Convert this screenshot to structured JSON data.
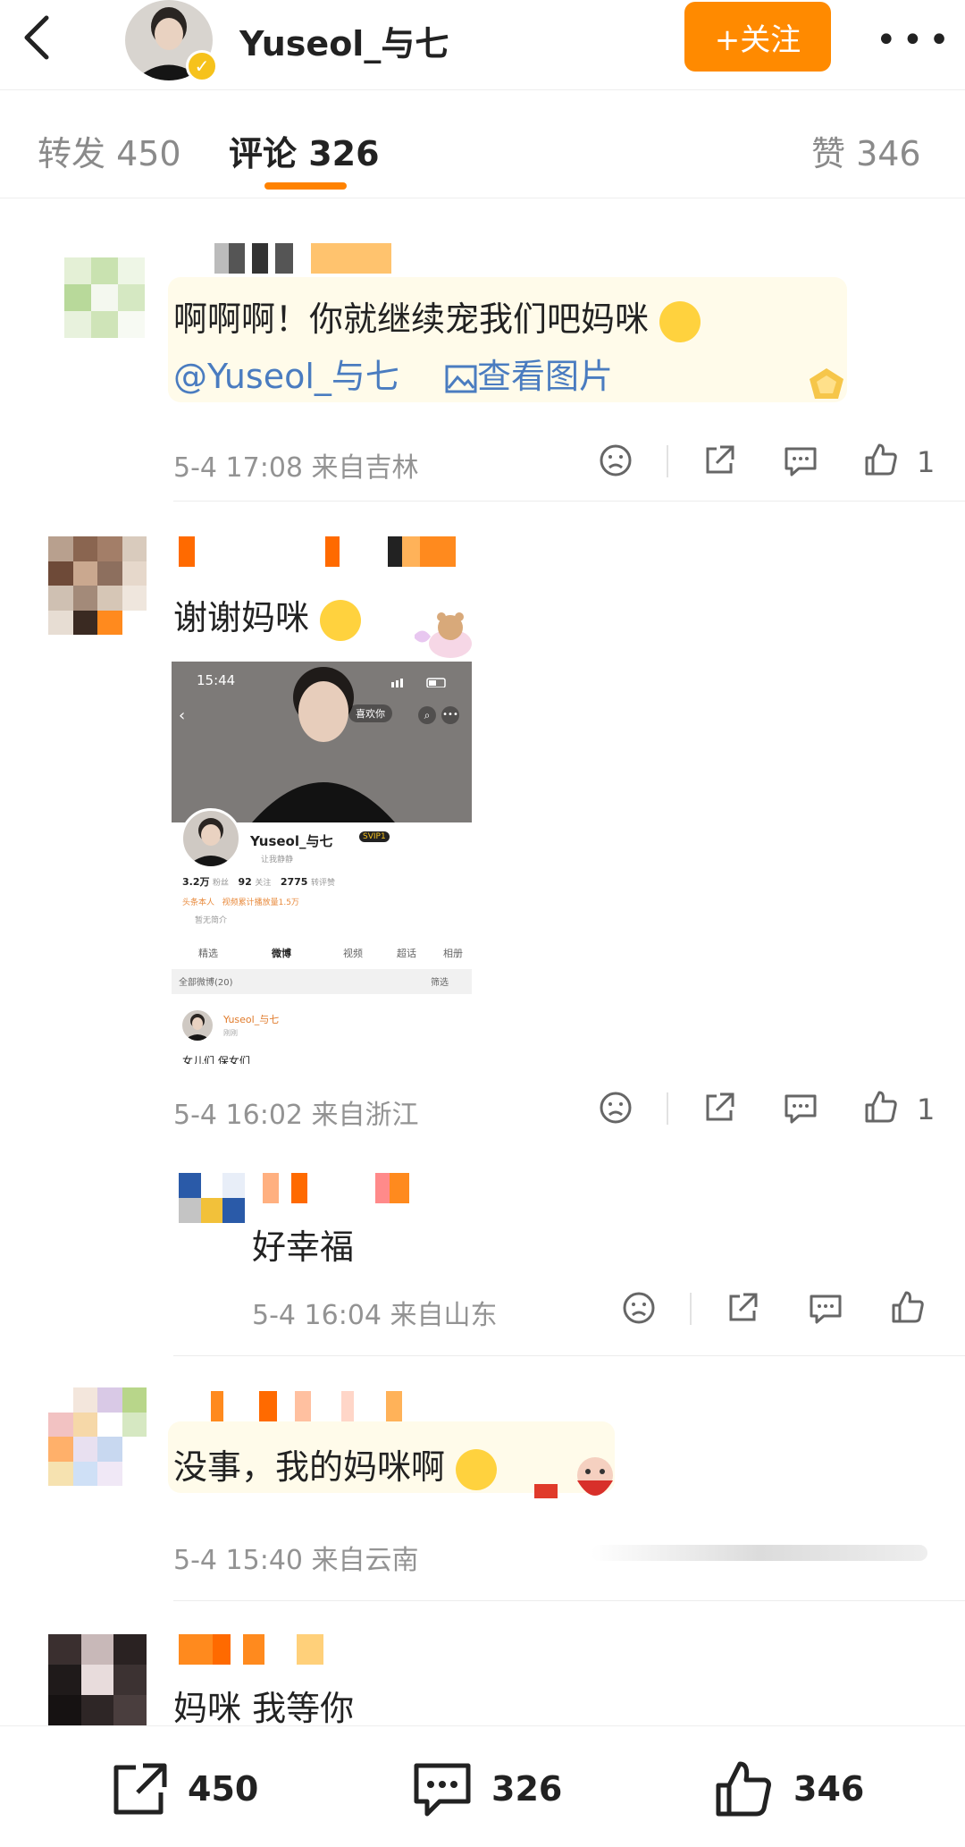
{
  "header": {
    "username": "Yuseol_与七",
    "follow_label": "+关注"
  },
  "tabs": {
    "repost": "转发 450",
    "comments": "评论 326",
    "likes": "赞 346"
  },
  "comments": [
    {
      "text": "啊啊啊！你就继续宠我们吧妈咪",
      "mention": "@Yuseol_与七",
      "view_image": "查看图片",
      "meta": "5-4 17:08 来自吉林",
      "like_count": "1"
    },
    {
      "text": "谢谢妈咪",
      "meta": "5-4 16:02 来自浙江",
      "like_count": "1",
      "reply": {
        "text": "好幸福",
        "meta": "5-4 16:04 来自山东"
      }
    },
    {
      "text": "没事，我的妈咪啊",
      "meta": "5-4 15:40 来自云南"
    },
    {
      "text": "妈咪 我等你"
    }
  ],
  "embedded_screenshot": {
    "time": "15:44",
    "like_chip": "喜欢你",
    "profile_name": "Yuseol_与七",
    "vip": "SVIP1",
    "sub": "让我静静",
    "fans_num": "3.2万",
    "fans_label": "粉丝",
    "follow_num": "92",
    "follow_label": "关注",
    "zan_num": "2775",
    "zan_label": "转评赞",
    "tag1": "头条本人",
    "tag2": "视频累计播放量1.5万",
    "intro": "暂无简介",
    "nav": [
      "精选",
      "微博",
      "视频",
      "超话",
      "相册"
    ],
    "all_posts": "全部微博(20)",
    "filter": "筛选",
    "post_name": "Yuseol_与七",
    "post_time": "刚刚",
    "post_text": "女儿们 保女们"
  },
  "bottom_bar": {
    "repost_count": "450",
    "comment_count": "326",
    "like_count": "346"
  },
  "colors": {
    "accent": "#ff8200",
    "link": "#4a7cc0",
    "meta": "#939393"
  }
}
